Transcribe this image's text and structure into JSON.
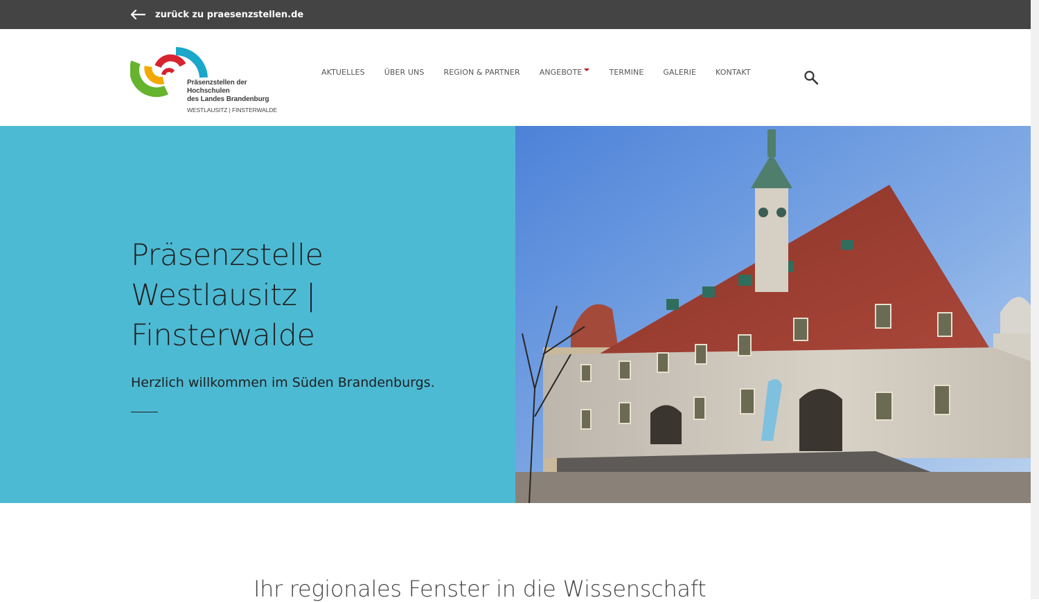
{
  "topbar": {
    "back_label": "zurück zu praesenzstellen.de"
  },
  "logo": {
    "line1": "Präsenzstellen der Hochschulen",
    "line2": "des Landes Brandenburg",
    "line3": "WESTLAUSITZ | FINSTERWALDE",
    "colors": [
      "#66b32e",
      "#f2a900",
      "#d6232f",
      "#1aa7c9"
    ]
  },
  "nav": {
    "items": [
      {
        "label": "AKTUELLES"
      },
      {
        "label": "ÜBER UNS"
      },
      {
        "label": "REGION & PARTNER"
      },
      {
        "label": "ANGEBOTE"
      },
      {
        "label": "TERMINE"
      },
      {
        "label": "GALERIE"
      },
      {
        "label": "KONTAKT"
      }
    ],
    "search_icon": "search-icon"
  },
  "hero": {
    "title_lines": [
      "Präsenzstelle",
      "Westlausitz |",
      "Finsterwalde"
    ],
    "subtitle": "Herzlich willkommen im Süden Brandenburgs.",
    "background": "#4dbad4"
  },
  "section": {
    "title": "Ihr regionales Fenster in die Wissenschaft"
  }
}
